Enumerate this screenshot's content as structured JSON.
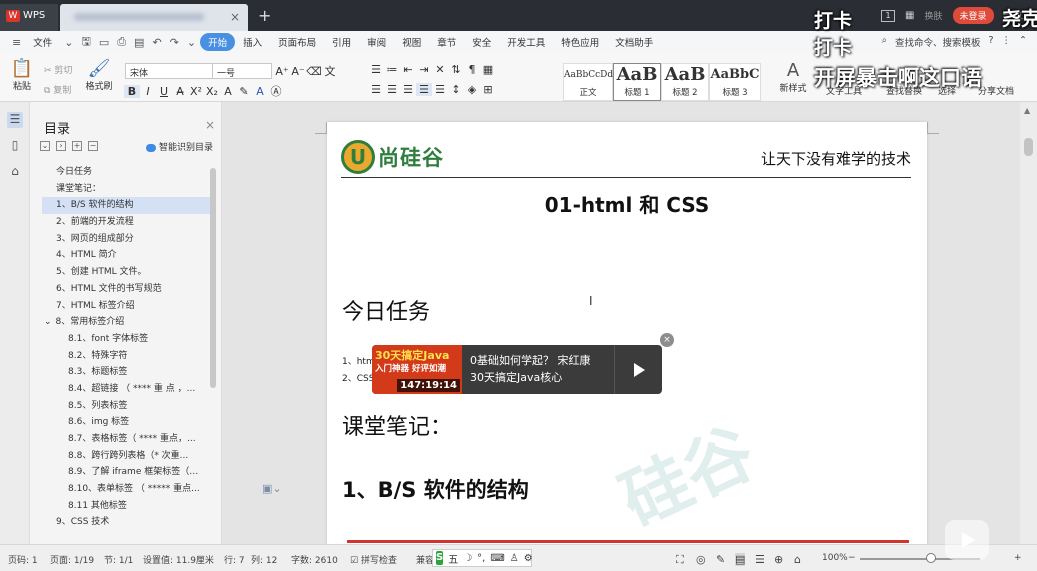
{
  "titlebar": {
    "app_name": "WPS",
    "new_tab": "+",
    "badge": "1",
    "skin_label": "换肤",
    "login_button": "未登录"
  },
  "menu": {
    "file": "文件",
    "tabs": [
      "开始",
      "插入",
      "页面布局",
      "引用",
      "审阅",
      "视图",
      "章节",
      "安全",
      "开发工具",
      "特色应用",
      "文档助手"
    ],
    "active_tab": "开始",
    "search": "查找命令、搜索模板"
  },
  "ribbon": {
    "paste": "粘贴",
    "cut": "剪切",
    "copy": "复制",
    "format_painter": "格式刷",
    "font_name": "宋体",
    "font_size": "一号",
    "styles": [
      {
        "sample": "AaBbCcDd",
        "caption": "正文"
      },
      {
        "sample": "AaB",
        "caption": "标题 1"
      },
      {
        "sample": "AaB",
        "caption": "标题 2"
      },
      {
        "sample": "AaBbC",
        "caption": "标题 3"
      }
    ],
    "new_style": "新样式",
    "text_tools": "文字工具",
    "find_replace": "查找替换",
    "select": "选择",
    "share_doc": "分享文档"
  },
  "toc": {
    "title": "目录",
    "smart_label": "智能识别目录",
    "items": [
      {
        "label": "今日任务",
        "indent": 0
      },
      {
        "label": "课堂笔记：",
        "indent": 0
      },
      {
        "label": "1、B/S 软件的结构",
        "indent": 0,
        "selected": true
      },
      {
        "label": "2、前端的开发流程",
        "indent": 0
      },
      {
        "label": "3、网页的组成部分",
        "indent": 0
      },
      {
        "label": "4、HTML 简介",
        "indent": 0
      },
      {
        "label": "5、创建 HTML 文件。",
        "indent": 0
      },
      {
        "label": "6、HTML 文件的书写规范",
        "indent": 0
      },
      {
        "label": "7、HTML 标签介绍",
        "indent": 0
      },
      {
        "label": "8、常用标签介绍",
        "indent": 0,
        "expander": "⌄"
      },
      {
        "label": "8.1、font 字体标签",
        "indent": 1
      },
      {
        "label": "8.2、特殊字符",
        "indent": 1
      },
      {
        "label": "8.3、标题标签",
        "indent": 1
      },
      {
        "label": "8.4、超链接 （ **** 重 点 ，...",
        "indent": 1
      },
      {
        "label": "8.5、列表标签",
        "indent": 1
      },
      {
        "label": "8.6、img 标签",
        "indent": 1
      },
      {
        "label": "8.7、表格标签（ **** 重点，...",
        "indent": 1
      },
      {
        "label": "8.8、跨行跨列表格（* 次重...",
        "indent": 1
      },
      {
        "label": "8.9、了解 iframe 框架标签（内...",
        "indent": 1
      },
      {
        "label": "8.10、表单标签 （ ***** 重点...",
        "indent": 1
      },
      {
        "label": "8.11 其他标签",
        "indent": 1
      },
      {
        "label": "9、CSS 技术",
        "indent": 0
      }
    ]
  },
  "document": {
    "logo_letter": "U",
    "logo_name": "尚硅谷",
    "slogan": "让天下没有难学的技术",
    "title": "01-html 和 CSS",
    "heading_today": "今日任务",
    "list_1": "1、htm",
    "list_2": "2、CSS",
    "heading_notes": "课堂笔记：",
    "heading_bs": "1、B/S  软件的结构",
    "watermark": "硅谷",
    "cursor": "I"
  },
  "ad": {
    "thumb_title": "30天搞定Java",
    "thumb_sub": "入门神器  好评如潮",
    "duration": "147:19:14",
    "line1": "0基础如何学起？ 宋红康",
    "line2": "30天搞定Java核心",
    "close": "×"
  },
  "status": {
    "page_num": "页码: 1",
    "pages": "页面: 1/19",
    "section": "节: 1/1",
    "setting": "设置值: 11.9厘米",
    "row": "行: 7",
    "col": "列: 12",
    "words": "字数: 2610",
    "spell": "拼写检查",
    "compat": "兼容",
    "ime_label": "五",
    "zoom": "100%"
  },
  "overlays": {
    "danmu": [
      "打卡",
      "打卡",
      "开屏暴击啊这口语",
      "尧克"
    ]
  }
}
